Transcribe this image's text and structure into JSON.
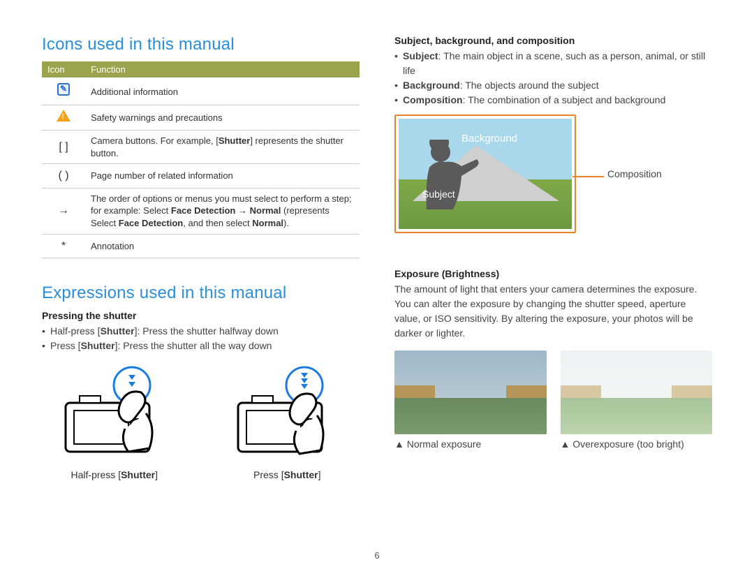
{
  "page_number": "6",
  "left": {
    "heading1": "Icons used in this manual",
    "table": {
      "head_icon": "Icon",
      "head_func": "Function",
      "rows": {
        "r1": "Additional information",
        "r2": "Safety warnings and precautions",
        "r3_a": "Camera buttons. For example, [",
        "r3_b": "Shutter",
        "r3_c": "] represents the shutter button.",
        "r3_icon": "[  ]",
        "r4": "Page number of related information",
        "r4_icon": "(  )",
        "r5_a": "The order of options or menus you must select to perform a step; for example: Select ",
        "r5_b": "Face Detection",
        "r5_c": " → ",
        "r5_d": "Normal",
        "r5_e": " (represents Select ",
        "r5_f": "Face Detection",
        "r5_g": ", and then select ",
        "r5_h": "Normal",
        "r5_i": ").",
        "r5_icon": "→",
        "r6": "Annotation",
        "r6_icon": "*"
      }
    },
    "heading2": "Expressions used in this manual",
    "pressing_title": "Pressing the shutter",
    "press_half_a": "Half-press [",
    "press_half_b": "Shutter",
    "press_half_c": "]: Press the shutter halfway down",
    "press_full_a": "Press [",
    "press_full_b": "Shutter",
    "press_full_c": "]: Press the shutter all the way down",
    "cap_half_a": "Half-press [",
    "cap_half_b": "Shutter",
    "cap_half_c": "]",
    "cap_full_a": "Press [",
    "cap_full_b": "Shutter",
    "cap_full_c": "]"
  },
  "right": {
    "sbc_title": "Subject, background, and composition",
    "li_subj_a": "Subject",
    "li_subj_b": ": The main object in a scene, such as a person, animal, or still life",
    "li_bg_a": "Background",
    "li_bg_b": ": The objects around the subject",
    "li_comp_a": "Composition",
    "li_comp_b": ": The combination of a subject and background",
    "diagram": {
      "background": "Background",
      "subject": "Subject",
      "composition": "Composition"
    },
    "expo_title": "Exposure (Brightness)",
    "expo_text": "The amount of light that enters your camera determines the exposure. You can alter the exposure by changing the shutter speed, aperture value, or ISO sensitivity. By altering the exposure, your photos will be darker or lighter.",
    "expo_caption_normal": "▲ Normal exposure",
    "expo_caption_over": "▲ Overexposure (too bright)"
  }
}
